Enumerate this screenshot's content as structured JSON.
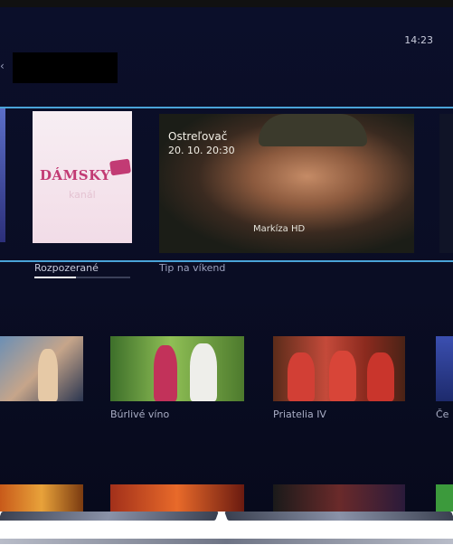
{
  "status": {
    "time": "14:23"
  },
  "hero": {
    "damsky": {
      "logo_text": "DÁMSKY",
      "sub_text": "kanál"
    },
    "featured": {
      "title": "Ostreľovač",
      "time": "20. 10. 20:30",
      "channel": "Markíza HD"
    }
  },
  "row_labels": {
    "watched": "Rozpozerané",
    "weekend_tip": "Tip na víkend"
  },
  "thumbnails": [
    {
      "caption": ""
    },
    {
      "caption": "Búrlivé víno"
    },
    {
      "caption": "Priatelia IV"
    },
    {
      "caption": "Če"
    }
  ],
  "colors": {
    "highlight_line": "#4aa3d8",
    "brand_pink": "#c23b74",
    "screen_bg": "#0b0f2a"
  }
}
